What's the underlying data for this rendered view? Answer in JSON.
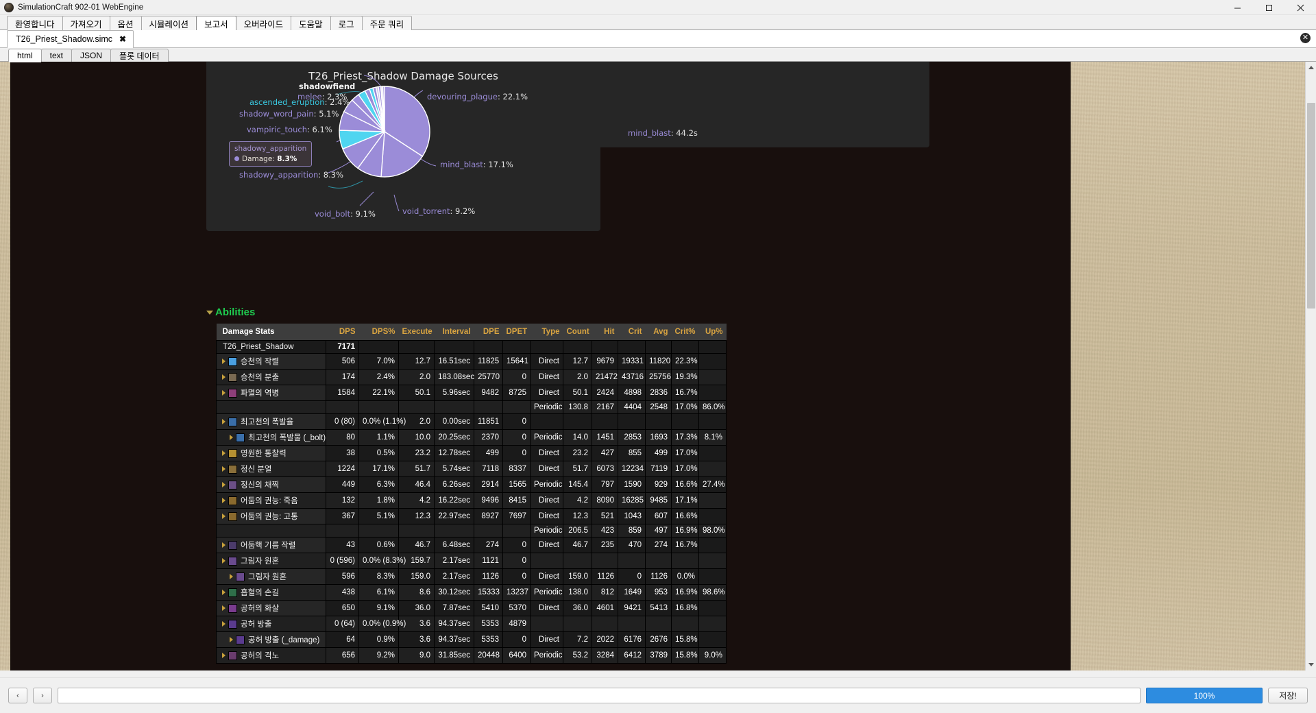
{
  "window": {
    "title": "SimulationCraft 902-01 WebEngine",
    "minimize": "–",
    "maximize": "❐",
    "close": "✕"
  },
  "main_tabs": [
    {
      "label": "환영합니다",
      "active": false
    },
    {
      "label": "가져오기",
      "active": false
    },
    {
      "label": "옵션",
      "active": false
    },
    {
      "label": "시뮬레이션",
      "active": false
    },
    {
      "label": "보고서",
      "active": true
    },
    {
      "label": "오버라이드",
      "active": false
    },
    {
      "label": "도움말",
      "active": false
    },
    {
      "label": "로그",
      "active": false
    },
    {
      "label": "주문 쿼리",
      "active": false
    }
  ],
  "document_tab": {
    "label": "T26_Priest_Shadow.simc",
    "close": "✖",
    "right_close": "✕"
  },
  "sub_tabs": [
    {
      "label": "html",
      "active": true
    },
    {
      "label": "text",
      "active": false
    },
    {
      "label": "JSON",
      "active": false
    },
    {
      "label": "플롯 데이터",
      "active": false
    }
  ],
  "report": {
    "section_title": "Abilities"
  },
  "chart_data": {
    "type": "pie",
    "title": "T26_Priest_Shadow Damage Sources",
    "labels": [
      "devouring_plague",
      "mind_blast",
      "void_torrent",
      "void_bolt",
      "shadowy_apparition",
      "vampiric_touch",
      "shadow_word_pain",
      "ascended_eruption",
      "shadowfiend melee"
    ],
    "values": [
      22.1,
      17.1,
      9.2,
      9.1,
      8.3,
      6.1,
      5.1,
      2.4,
      2.3
    ],
    "slices": [
      {
        "name": "devouring_plague",
        "value": 22.1,
        "label": "devouring_plague: 22.1%",
        "color": "#9b8cd8"
      },
      {
        "name": "mind_blast",
        "value": 17.1,
        "label": "mind_blast: 17.1%",
        "color": "#9b8cd8"
      },
      {
        "name": "void_torrent",
        "value": 9.2,
        "label": "void_torrent: 9.2%",
        "color": "#9b8cd8"
      },
      {
        "name": "void_bolt",
        "value": 9.1,
        "label": "void_bolt: 9.1%",
        "color": "#9b8cd8"
      },
      {
        "name": "shadowy_apparition",
        "value": 8.3,
        "label": "shadowy_apparition: 8.3%",
        "color": "#9b8cd8"
      },
      {
        "name": "vampiric_touch",
        "value": 6.1,
        "label": "vampiric_touch: 6.1%",
        "color": "#9b8cd8"
      },
      {
        "name": "shadow_word_pain",
        "value": 5.1,
        "label": "shadow_word_pain: 5.1%",
        "color": "#9b8cd8"
      },
      {
        "name": "ascended_eruption",
        "value": 2.4,
        "label": "ascended_eruption: 2.4%",
        "color": "#4fd5f0"
      },
      {
        "name": "shadowfiend_melee",
        "value": 2.3,
        "label": "melee: 2.3%",
        "color": "#9b8cd8"
      }
    ],
    "label_texts": {
      "devouring_plague": "devouring_plague",
      "devouring_plague_v": ": 22.1%",
      "mind_blast": "mind_blast",
      "mind_blast_v": ": 17.1%",
      "void_torrent": "void_torrent",
      "void_torrent_v": ": 9.2%",
      "void_bolt": "void_bolt",
      "void_bolt_v": ": 9.1%",
      "shadowy_apparition": "shadowy_apparition",
      "shadowy_apparition_v": ": 8.3%",
      "vampiric_touch": "vampiric_touch",
      "vampiric_touch_v": ": 6.1%",
      "shadow_word_pain": "shadow_word_pain",
      "shadow_word_pain_v": ": 5.1%",
      "ascended_eruption": "ascended_eruption",
      "ascended_eruption_v": ": 2.4%",
      "shadowfiend": "shadowfiend",
      "melee": "melee",
      "melee_v": ": 2.3%"
    },
    "tooltip": {
      "title": "shadowy_apparition",
      "metric": "Damage:",
      "value": "8.3%"
    },
    "secondary_card_label": "mind_blast",
    "secondary_card_value": ": 44.2s"
  },
  "table": {
    "columns": [
      "Damage Stats",
      "DPS",
      "DPS%",
      "Execute",
      "Interval",
      "DPE",
      "DPET",
      "Type",
      "Count",
      "Hit",
      "Crit",
      "Avg",
      "Crit%",
      "Up%"
    ],
    "rows": [
      {
        "kind": "total",
        "name": "T26_Priest_Shadow",
        "dps": "7171",
        "dpspct": "",
        "execute": "",
        "interval": "",
        "dpe": "",
        "dpet": "",
        "type": "",
        "count": "",
        "hit": "",
        "crit": "",
        "avg": "",
        "critpct": "",
        "uppct": ""
      },
      {
        "kind": "ability",
        "indent": 0,
        "icon": "#4a9fe0",
        "name": "승천의 작렬",
        "dps": "506",
        "dpspct": "7.0%",
        "execute": "12.7",
        "interval": "16.51sec",
        "dpe": "11825",
        "dpet": "15641",
        "type": "Direct",
        "count": "12.7",
        "hit": "9679",
        "crit": "19331",
        "avg": "11820",
        "critpct": "22.3%",
        "uppct": ""
      },
      {
        "kind": "ability",
        "indent": 0,
        "icon": "#7a6a52",
        "name": "승천의 분출",
        "dps": "174",
        "dpspct": "2.4%",
        "execute": "2.0",
        "interval": "183.08sec",
        "dpe": "25770",
        "dpet": "0",
        "type": "Direct",
        "count": "2.0",
        "hit": "21472",
        "crit": "43716",
        "avg": "25756",
        "critpct": "19.3%",
        "uppct": ""
      },
      {
        "kind": "ability",
        "indent": 0,
        "icon": "#8e3f7a",
        "name": "파멸의 역병",
        "dps": "1584",
        "dpspct": "22.1%",
        "execute": "50.1",
        "interval": "5.96sec",
        "dpe": "9482",
        "dpet": "8725",
        "type": "Direct",
        "count": "50.1",
        "hit": "2424",
        "crit": "4898",
        "avg": "2836",
        "critpct": "16.7%",
        "uppct": ""
      },
      {
        "kind": "sub",
        "name": "",
        "dps": "",
        "dpspct": "",
        "execute": "",
        "interval": "",
        "dpe": "",
        "dpet": "",
        "type": "Periodic",
        "count": "130.8",
        "hit": "2167",
        "crit": "4404",
        "avg": "2548",
        "critpct": "17.0%",
        "uppct": "86.0%"
      },
      {
        "kind": "ability",
        "indent": 0,
        "icon": "#3a6ea8",
        "name": "최고천의 폭발율",
        "dps": "0 (80)",
        "dpspct": "0.0% (1.1%)",
        "execute": "2.0",
        "interval": "0.00sec",
        "dpe": "11851",
        "dpet": "0",
        "type": "",
        "count": "",
        "hit": "",
        "crit": "",
        "avg": "",
        "critpct": "",
        "uppct": ""
      },
      {
        "kind": "ability",
        "indent": 1,
        "icon": "#3a6ea8",
        "name": "최고천의 폭발물 (_bolt)",
        "dps": "80",
        "dpspct": "1.1%",
        "execute": "10.0",
        "interval": "20.25sec",
        "dpe": "2370",
        "dpet": "0",
        "type": "Periodic",
        "count": "14.0",
        "hit": "1451",
        "crit": "2853",
        "avg": "1693",
        "critpct": "17.3%",
        "uppct": "8.1%"
      },
      {
        "kind": "ability",
        "indent": 0,
        "icon": "#b59032",
        "name": "영원한 통찰력",
        "dps": "38",
        "dpspct": "0.5%",
        "execute": "23.2",
        "interval": "12.78sec",
        "dpe": "499",
        "dpet": "0",
        "type": "Direct",
        "count": "23.2",
        "hit": "427",
        "crit": "855",
        "avg": "499",
        "critpct": "17.0%",
        "uppct": ""
      },
      {
        "kind": "ability",
        "indent": 0,
        "icon": "#8a6f3a",
        "name": "정신 분열",
        "dps": "1224",
        "dpspct": "17.1%",
        "execute": "51.7",
        "interval": "5.74sec",
        "dpe": "7118",
        "dpet": "8337",
        "type": "Direct",
        "count": "51.7",
        "hit": "6073",
        "crit": "12234",
        "avg": "7119",
        "critpct": "17.0%",
        "uppct": ""
      },
      {
        "kind": "ability",
        "indent": 0,
        "icon": "#6b4f86",
        "name": "정신의 채찍",
        "dps": "449",
        "dpspct": "6.3%",
        "execute": "46.4",
        "interval": "6.26sec",
        "dpe": "2914",
        "dpet": "1565",
        "type": "Periodic",
        "count": "145.4",
        "hit": "797",
        "crit": "1590",
        "avg": "929",
        "critpct": "16.6%",
        "uppct": "27.4%"
      },
      {
        "kind": "ability",
        "indent": 0,
        "icon": "#8a6a2e",
        "name": "어둠의 권능: 죽음",
        "dps": "132",
        "dpspct": "1.8%",
        "execute": "4.2",
        "interval": "16.22sec",
        "dpe": "9496",
        "dpet": "8415",
        "type": "Direct",
        "count": "4.2",
        "hit": "8090",
        "crit": "16285",
        "avg": "9485",
        "critpct": "17.1%",
        "uppct": ""
      },
      {
        "kind": "ability",
        "indent": 0,
        "icon": "#8a6a2e",
        "name": "어둠의 권능: 고통",
        "dps": "367",
        "dpspct": "5.1%",
        "execute": "12.3",
        "interval": "22.97sec",
        "dpe": "8927",
        "dpet": "7697",
        "type": "Direct",
        "count": "12.3",
        "hit": "521",
        "crit": "1043",
        "avg": "607",
        "critpct": "16.6%",
        "uppct": ""
      },
      {
        "kind": "sub",
        "name": "",
        "dps": "",
        "dpspct": "",
        "execute": "",
        "interval": "",
        "dpe": "",
        "dpet": "",
        "type": "Periodic",
        "count": "206.5",
        "hit": "423",
        "crit": "859",
        "avg": "497",
        "critpct": "16.9%",
        "uppct": "98.0%"
      },
      {
        "kind": "ability",
        "indent": 0,
        "icon": "#4b3b6b",
        "name": "어둠핵 기름 작렬",
        "dps": "43",
        "dpspct": "0.6%",
        "execute": "46.7",
        "interval": "6.48sec",
        "dpe": "274",
        "dpet": "0",
        "type": "Direct",
        "count": "46.7",
        "hit": "235",
        "crit": "470",
        "avg": "274",
        "critpct": "16.7%",
        "uppct": ""
      },
      {
        "kind": "ability",
        "indent": 0,
        "icon": "#6a4b8e",
        "name": "그림자 원혼",
        "dps": "0 (596)",
        "dpspct": "0.0% (8.3%)",
        "execute": "159.7",
        "interval": "2.17sec",
        "dpe": "1121",
        "dpet": "0",
        "type": "",
        "count": "",
        "hit": "",
        "crit": "",
        "avg": "",
        "critpct": "",
        "uppct": ""
      },
      {
        "kind": "ability",
        "indent": 1,
        "icon": "#6a4b8e",
        "name": "그림자 원혼",
        "dps": "596",
        "dpspct": "8.3%",
        "execute": "159.0",
        "interval": "2.17sec",
        "dpe": "1126",
        "dpet": "0",
        "type": "Direct",
        "count": "159.0",
        "hit": "1126",
        "crit": "0",
        "avg": "1126",
        "critpct": "0.0%",
        "uppct": ""
      },
      {
        "kind": "ability",
        "indent": 0,
        "icon": "#2f6f4a",
        "name": "흡혈의 손길",
        "dps": "438",
        "dpspct": "6.1%",
        "execute": "8.6",
        "interval": "30.12sec",
        "dpe": "15333",
        "dpet": "13237",
        "type": "Periodic",
        "count": "138.0",
        "hit": "812",
        "crit": "1649",
        "avg": "953",
        "critpct": "16.9%",
        "uppct": "98.6%"
      },
      {
        "kind": "ability",
        "indent": 0,
        "icon": "#7a3c8e",
        "name": "공허의 화살",
        "dps": "650",
        "dpspct": "9.1%",
        "execute": "36.0",
        "interval": "7.87sec",
        "dpe": "5410",
        "dpet": "5370",
        "type": "Direct",
        "count": "36.0",
        "hit": "4601",
        "crit": "9421",
        "avg": "5413",
        "critpct": "16.8%",
        "uppct": ""
      },
      {
        "kind": "ability",
        "indent": 0,
        "icon": "#5a3b8e",
        "name": "공허 방출",
        "dps": "0 (64)",
        "dpspct": "0.0% (0.9%)",
        "execute": "3.6",
        "interval": "94.37sec",
        "dpe": "5353",
        "dpet": "4879",
        "type": "",
        "count": "",
        "hit": "",
        "crit": "",
        "avg": "",
        "critpct": "",
        "uppct": ""
      },
      {
        "kind": "ability",
        "indent": 1,
        "icon": "#5a3b8e",
        "name": "공허 방출 (_damage)",
        "dps": "64",
        "dpspct": "0.9%",
        "execute": "3.6",
        "interval": "94.37sec",
        "dpe": "5353",
        "dpet": "0",
        "type": "Direct",
        "count": "7.2",
        "hit": "2022",
        "crit": "6176",
        "avg": "2676",
        "critpct": "15.8%",
        "uppct": ""
      },
      {
        "kind": "ability",
        "indent": 0,
        "icon": "#6a3c6e",
        "name": "공허의 격노",
        "dps": "656",
        "dpspct": "9.2%",
        "execute": "9.0",
        "interval": "31.85sec",
        "dpe": "20448",
        "dpet": "6400",
        "type": "Periodic",
        "count": "53.2",
        "hit": "3284",
        "crit": "6412",
        "avg": "3789",
        "critpct": "15.8%",
        "uppct": "9.0%"
      }
    ]
  },
  "bottom": {
    "back": "‹",
    "forward": "›",
    "url": "",
    "progress": "100%",
    "save": "저장!"
  }
}
